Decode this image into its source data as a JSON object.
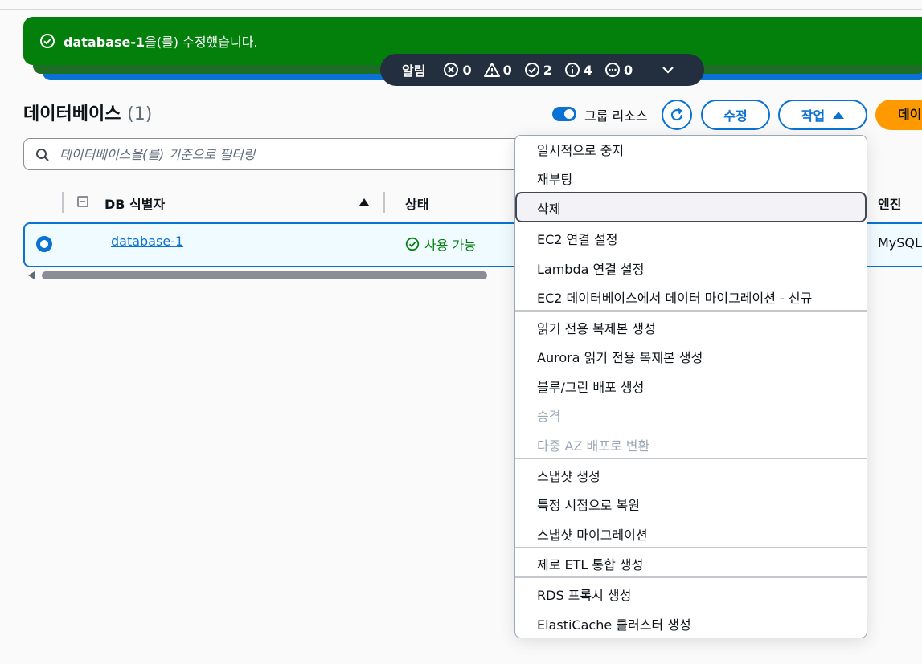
{
  "flash": {
    "resource_name": "database-1",
    "message_rest": "을(를) 수정했습니다."
  },
  "notifications": {
    "label": "알림",
    "counts": {
      "error": "0",
      "warning": "0",
      "success": "2",
      "info": "4",
      "in_progress": "0"
    }
  },
  "header": {
    "title": "데이터베이스",
    "count": "(1)",
    "group_toggle_label": "그룹 리소스",
    "edit_button": "수정",
    "actions_button": "작업",
    "create_button": "데이"
  },
  "search": {
    "placeholder": "데이터베이스을(를) 기준으로 필터링"
  },
  "table": {
    "columns": [
      "DB 식별자",
      "상태",
      "엔진"
    ],
    "rows": [
      {
        "id": "database-1",
        "status": "사용 가능",
        "engine": "MySQL"
      }
    ]
  },
  "actions_menu": {
    "items": [
      "일시적으로 중지",
      "재부팅",
      "삭제",
      "EC2 연결 설정",
      "Lambda 연결 설정",
      "EC2 데이터베이스에서 데이터 마이그레이션 - 신규",
      "읽기 전용 복제본 생성",
      "Aurora 읽기 전용 복제본 생성",
      "블루/그린 배포 생성",
      "승격",
      "다중 AZ 배포로 변환",
      "스냅샷 생성",
      "특정 시점으로 복원",
      "스냅샷 마이그레이션",
      "제로 ETL 통합 생성",
      "RDS 프록시 생성",
      "ElastiCache 클러스터 생성"
    ]
  },
  "colors": {
    "success": "#037f0c",
    "accent": "#0972d3",
    "primary_button": "#ff9900",
    "notif_bar": "#232f3e"
  }
}
